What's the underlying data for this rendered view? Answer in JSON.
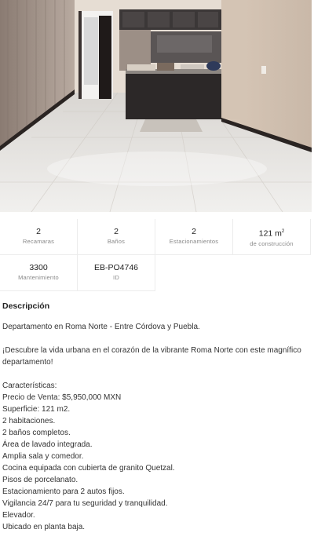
{
  "listing": {
    "stats_row1": [
      {
        "value": "2",
        "label": "Recamaras"
      },
      {
        "value": "2",
        "label": "Baños"
      },
      {
        "value": "2",
        "label": "Estacionamientos"
      },
      {
        "value": "121 m",
        "sup": "2",
        "label": "de construcción"
      }
    ],
    "stats_row2": [
      {
        "value": "3300",
        "label": "Mantenimiento"
      },
      {
        "value": "EB-PO4746",
        "label": "ID"
      }
    ]
  },
  "description": {
    "title": "Descripción",
    "intro": "Departamento en Roma Norte - Entre Córdova y Puebla.",
    "hook": "¡Descubre la vida urbana en el corazón de la vibrante Roma Norte con este magnífico departamento!",
    "features_title": "Características:",
    "features": [
      "Precio de Venta: $5,950,000 MXN",
      "Superficie: 121 m2.",
      "2 habitaciones.",
      "2 baños completos.",
      "Área de lavado integrada.",
      "Amplia sala y comedor.",
      "Cocina equipada con cubierta de granito Quetzal.",
      "Pisos de porcelanato.",
      "Estacionamiento para 2 autos fijos.",
      "Vigilancia 24/7 para tu seguridad y tranquilidad.",
      "Elevador.",
      "Ubicado en planta baja."
    ]
  }
}
